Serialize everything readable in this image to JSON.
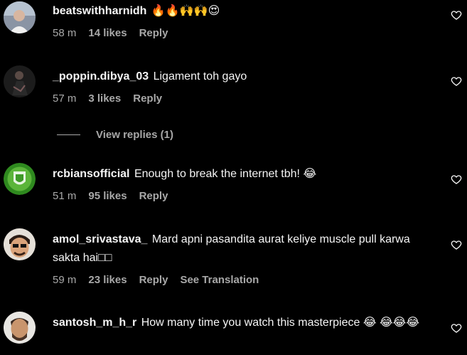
{
  "colors": {
    "background": "#000000",
    "primary_text": "#f5f5f5",
    "secondary_text": "#a8a8a8"
  },
  "comments": [
    {
      "username": "beatswithharnidh",
      "text": "🔥🔥🙌🙌😍",
      "time": "58 m",
      "likes": "14 likes",
      "reply": "Reply",
      "avatar_icon": "avatar-photo"
    },
    {
      "username": "_poppin.dibya_03",
      "text": "Ligament toh gayo",
      "time": "57 m",
      "likes": "3 likes",
      "reply": "Reply",
      "avatar_icon": "avatar-photo"
    },
    {
      "username": "rcbiansofficial",
      "text": "Enough to break the internet tbh! 😂",
      "time": "51 m",
      "likes": "95 likes",
      "reply": "Reply",
      "avatar_icon": "rcb-logo"
    },
    {
      "username": "amol_srivastava_",
      "text": "Mard apni pasandita aurat keliye muscle pull karwa sakta hai□□",
      "time": "59 m",
      "likes": "23 likes",
      "reply": "Reply",
      "translate": "See Translation",
      "avatar_icon": "avatar-photo"
    },
    {
      "username": "santosh_m_h_r",
      "text": "How many time you watch this masterpiece 😂 😂😂😂",
      "avatar_icon": "avatar-photo"
    }
  ],
  "view_replies": "View replies (1)"
}
